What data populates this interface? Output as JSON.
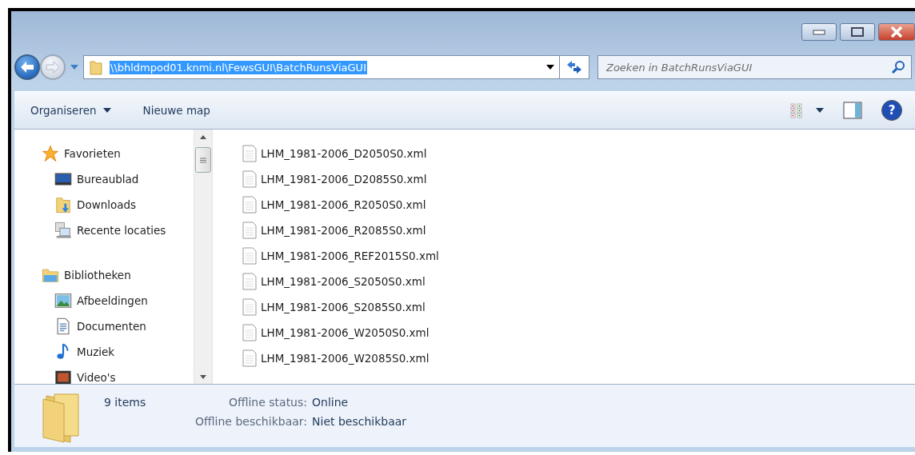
{
  "address_bar": {
    "path": "\\\\bhldmpod01.knmi.nl\\FewsGUI\\BatchRunsViaGUI"
  },
  "search": {
    "placeholder": "Zoeken in BatchRunsViaGUI"
  },
  "toolbar": {
    "items": [
      "Organiseren",
      "Nieuwe map"
    ],
    "help_label": "?"
  },
  "sidebar": {
    "groups": [
      {
        "label": "Favorieten",
        "kind": "favorites",
        "children": [
          {
            "label": "Bureaublad",
            "kind": "desktop"
          },
          {
            "label": "Downloads",
            "kind": "downloads"
          },
          {
            "label": "Recente locaties",
            "kind": "recent"
          }
        ]
      },
      {
        "label": "Bibliotheken",
        "kind": "libraries",
        "children": [
          {
            "label": "Afbeeldingen",
            "kind": "pictures"
          },
          {
            "label": "Documenten",
            "kind": "documents"
          },
          {
            "label": "Muziek",
            "kind": "music"
          },
          {
            "label": "Video's",
            "kind": "videos"
          }
        ]
      }
    ]
  },
  "files": [
    {
      "name": "LHM_1981-2006_D2050S0.xml"
    },
    {
      "name": "LHM_1981-2006_D2085S0.xml"
    },
    {
      "name": "LHM_1981-2006_R2050S0.xml"
    },
    {
      "name": "LHM_1981-2006_R2085S0.xml"
    },
    {
      "name": "LHM_1981-2006_REF2015S0.xml"
    },
    {
      "name": "LHM_1981-2006_S2050S0.xml"
    },
    {
      "name": "LHM_1981-2006_S2085S0.xml"
    },
    {
      "name": "LHM_1981-2006_W2050S0.xml"
    },
    {
      "name": "LHM_1981-2006_W2085S0.xml"
    }
  ],
  "details": {
    "count": "9 items",
    "fields": [
      {
        "label": "Offline status:",
        "value": "Online"
      },
      {
        "label": "Offline beschikbaar:",
        "value": "Niet beschikbaar"
      }
    ]
  }
}
